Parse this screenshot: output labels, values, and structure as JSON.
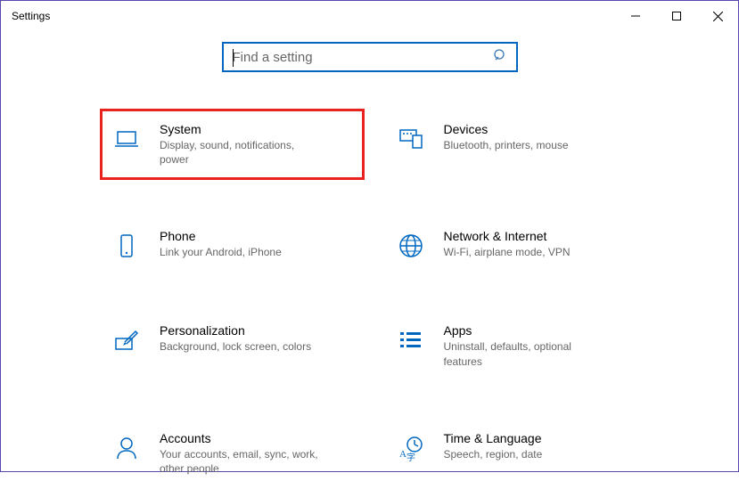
{
  "window": {
    "title": "Settings"
  },
  "search": {
    "placeholder": "Find a setting"
  },
  "tiles": {
    "system": {
      "title": "System",
      "sub": "Display, sound, notifications, power"
    },
    "devices": {
      "title": "Devices",
      "sub": "Bluetooth, printers, mouse"
    },
    "phone": {
      "title": "Phone",
      "sub": "Link your Android, iPhone"
    },
    "network": {
      "title": "Network & Internet",
      "sub": "Wi-Fi, airplane mode, VPN"
    },
    "personalization": {
      "title": "Personalization",
      "sub": "Background, lock screen, colors"
    },
    "apps": {
      "title": "Apps",
      "sub": "Uninstall, defaults, optional features"
    },
    "accounts": {
      "title": "Accounts",
      "sub": "Your accounts, email, sync, work, other people"
    },
    "timelang": {
      "title": "Time & Language",
      "sub": "Speech, region, date"
    }
  }
}
